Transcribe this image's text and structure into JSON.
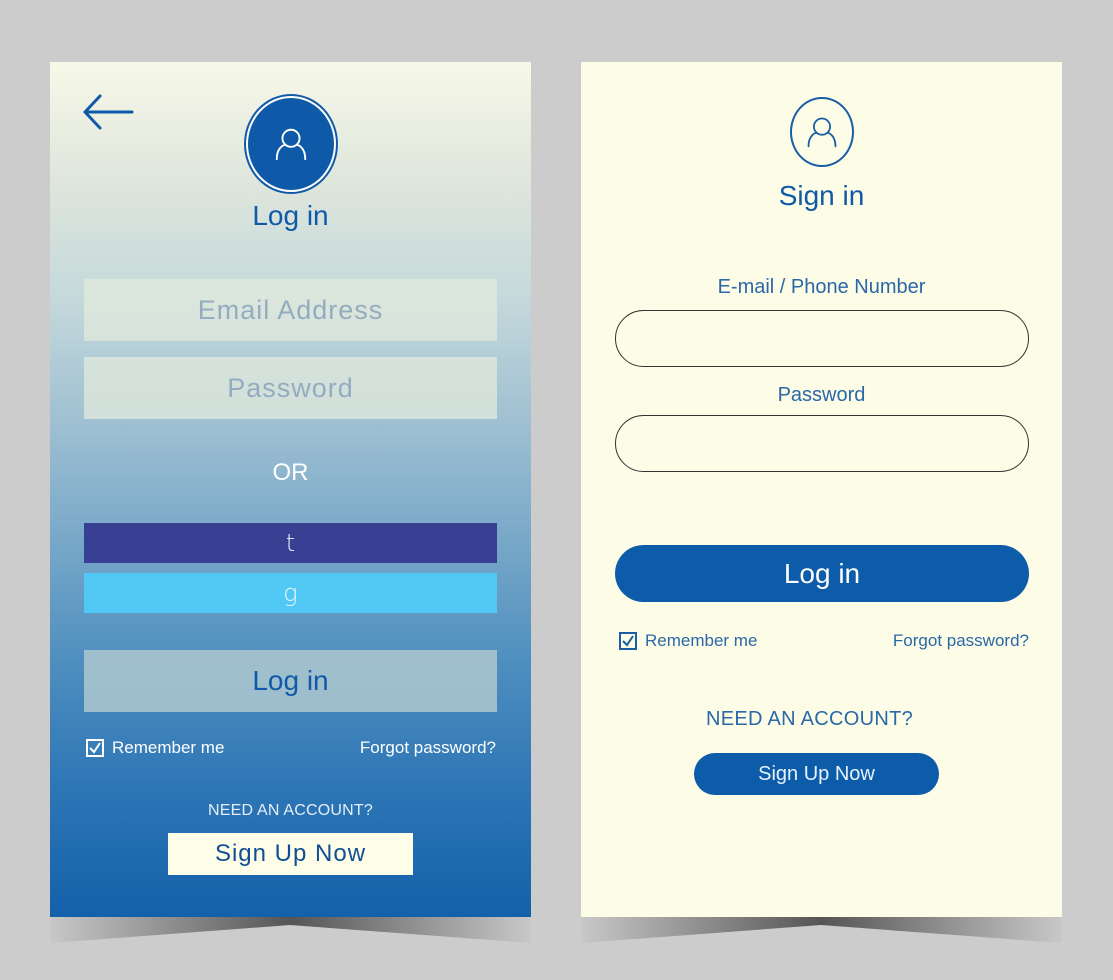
{
  "colors": {
    "brand_blue": "#0f5aa8",
    "twitter_button": "#374092",
    "google_button": "#52c9f4",
    "cream": "#fcfce7",
    "page_background": "#cccccc"
  },
  "left_screen": {
    "back_icon": "arrow-left",
    "avatar_icon": "user-icon",
    "title": "Log in",
    "email_placeholder": "Email Address",
    "password_placeholder": "Password",
    "divider_text": "OR",
    "social_buttons": [
      {
        "label": "t",
        "service": "twitter"
      },
      {
        "label": "g",
        "service": "google"
      }
    ],
    "login_button": "Log in",
    "remember_me": {
      "label": "Remember me",
      "checked": true
    },
    "forgot_password": "Forgot password?",
    "need_account": "NEED AN ACCOUNT?",
    "signup_button": "Sign Up Now"
  },
  "right_screen": {
    "avatar_icon": "user-icon",
    "title": "Sign in",
    "email_label": "E-mail / Phone Number",
    "email_value": "",
    "password_label": "Password",
    "password_value": "",
    "login_button": "Log in",
    "remember_me": {
      "label": "Remember me",
      "checked": true
    },
    "forgot_password": "Forgot password?",
    "need_account": "NEED AN ACCOUNT?",
    "signup_button": "Sign Up Now"
  }
}
